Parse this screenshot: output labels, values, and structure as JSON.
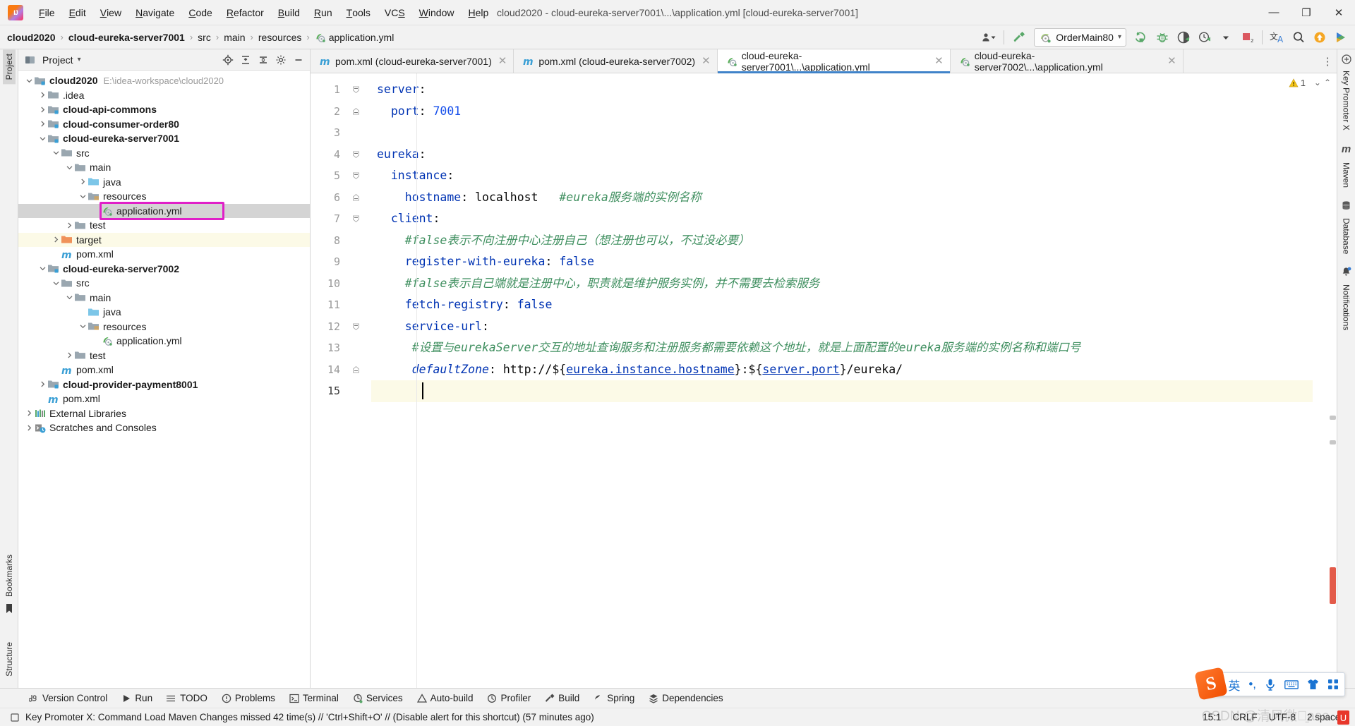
{
  "window": {
    "title": "cloud2020 - cloud-eureka-server7001\\...\\application.yml [cloud-eureka-server7001]",
    "minimize": "—",
    "maximize": "❐",
    "close": "✕"
  },
  "menu": {
    "items": [
      "File",
      "Edit",
      "View",
      "Navigate",
      "Code",
      "Refactor",
      "Build",
      "Run",
      "Tools",
      "VCS",
      "Window",
      "Help"
    ]
  },
  "breadcrumb": {
    "items": [
      "cloud2020",
      "cloud-eureka-server7001",
      "src",
      "main",
      "resources",
      "application.yml"
    ],
    "separator": "›"
  },
  "run_config": {
    "name": "OrderMain80",
    "dropdown": "▾"
  },
  "nav_icons": [
    "user-dropdown-icon",
    "hammer-build-icon",
    "run-icon",
    "debug-icon",
    "run-coverage-icon",
    "run-profile-icon",
    "more-dropdown-icon",
    "stop-icon",
    "translate-icon",
    "search-everywhere-icon",
    "update-icon",
    "ide-eval-icon"
  ],
  "project_panel": {
    "title": "Project",
    "dropdown": "▾",
    "header_icons": [
      "locate-icon",
      "collapse-selection-icon",
      "expand-all-icon",
      "collapse-all-icon",
      "settings-gear-icon",
      "hide-icon"
    ],
    "tree": [
      {
        "depth": 0,
        "arrow": "expanded",
        "icon": "module-folder",
        "label": "cloud2020",
        "bold": true,
        "path": "E:\\idea-workspace\\cloud2020"
      },
      {
        "depth": 1,
        "arrow": "collapsed",
        "icon": "folder",
        "label": ".idea",
        "bold": false
      },
      {
        "depth": 1,
        "arrow": "collapsed",
        "icon": "module-folder",
        "label": "cloud-api-commons",
        "bold": true
      },
      {
        "depth": 1,
        "arrow": "collapsed",
        "icon": "module-folder",
        "label": "cloud-consumer-order80",
        "bold": true
      },
      {
        "depth": 1,
        "arrow": "expanded",
        "icon": "module-folder",
        "label": "cloud-eureka-server7001",
        "bold": true
      },
      {
        "depth": 2,
        "arrow": "expanded",
        "icon": "folder",
        "label": "src",
        "bold": false
      },
      {
        "depth": 3,
        "arrow": "expanded",
        "icon": "folder",
        "label": "main",
        "bold": false
      },
      {
        "depth": 4,
        "arrow": "collapsed",
        "icon": "source-folder",
        "label": "java",
        "bold": false
      },
      {
        "depth": 4,
        "arrow": "expanded",
        "icon": "resource-folder",
        "label": "resources",
        "bold": false
      },
      {
        "depth": 5,
        "arrow": "none",
        "icon": "yml-file",
        "label": "application.yml",
        "bold": false,
        "selected": true,
        "boxed": true
      },
      {
        "depth": 3,
        "arrow": "collapsed",
        "icon": "folder",
        "label": "test",
        "bold": false
      },
      {
        "depth": 2,
        "arrow": "collapsed",
        "icon": "target-folder",
        "label": "target",
        "bold": false,
        "row_highlight": true
      },
      {
        "depth": 2,
        "arrow": "none",
        "icon": "maven-file",
        "label": "pom.xml",
        "bold": false
      },
      {
        "depth": 1,
        "arrow": "expanded",
        "icon": "module-folder",
        "label": "cloud-eureka-server7002",
        "bold": true
      },
      {
        "depth": 2,
        "arrow": "expanded",
        "icon": "folder",
        "label": "src",
        "bold": false
      },
      {
        "depth": 3,
        "arrow": "expanded",
        "icon": "folder",
        "label": "main",
        "bold": false
      },
      {
        "depth": 4,
        "arrow": "none",
        "icon": "source-folder",
        "label": "java",
        "bold": false
      },
      {
        "depth": 4,
        "arrow": "expanded",
        "icon": "resource-folder",
        "label": "resources",
        "bold": false
      },
      {
        "depth": 5,
        "arrow": "none",
        "icon": "yml-file",
        "label": "application.yml",
        "bold": false
      },
      {
        "depth": 3,
        "arrow": "collapsed",
        "icon": "folder",
        "label": "test",
        "bold": false
      },
      {
        "depth": 2,
        "arrow": "none",
        "icon": "maven-file",
        "label": "pom.xml",
        "bold": false
      },
      {
        "depth": 1,
        "arrow": "collapsed",
        "icon": "module-folder",
        "label": "cloud-provider-payment8001",
        "bold": true
      },
      {
        "depth": 1,
        "arrow": "none",
        "icon": "maven-file",
        "label": "pom.xml",
        "bold": false
      },
      {
        "depth": 0,
        "arrow": "collapsed",
        "icon": "library-icon",
        "label": "External Libraries",
        "bold": false
      },
      {
        "depth": 0,
        "arrow": "collapsed",
        "icon": "scratches-icon",
        "label": "Scratches and Consoles",
        "bold": false
      }
    ]
  },
  "left_rail": {
    "tabs": [
      "Project",
      "Bookmarks",
      "Structure"
    ]
  },
  "right_rail": {
    "tabs": [
      "Key Promoter X",
      "Maven",
      "Database",
      "Notifications"
    ]
  },
  "editor_tabs": [
    {
      "icon": "maven-file",
      "label": "pom.xml (cloud-eureka-server7001)",
      "active": false,
      "close": "✕"
    },
    {
      "icon": "maven-file",
      "label": "pom.xml (cloud-eureka-server7002)",
      "active": false,
      "close": "✕"
    },
    {
      "icon": "yml-file",
      "label": "cloud-eureka-server7001\\...\\application.yml",
      "active": true,
      "close": "✕"
    },
    {
      "icon": "yml-file",
      "label": "cloud-eureka-server7002\\...\\application.yml",
      "active": false,
      "close": "✕"
    }
  ],
  "editor": {
    "warning_count": "1",
    "line_numbers": [
      "1",
      "2",
      "3",
      "4",
      "5",
      "6",
      "7",
      "8",
      "9",
      "10",
      "11",
      "12",
      "13",
      "14",
      "15"
    ],
    "current_line": 15,
    "lines": [
      {
        "n": 1,
        "fold": "minus-tri",
        "tokens": [
          {
            "t": "server",
            "c": "k"
          },
          {
            "t": ":",
            "c": "plain"
          }
        ]
      },
      {
        "n": 2,
        "fold": "minus-end",
        "tokens": [
          {
            "t": "  ",
            "c": "plain"
          },
          {
            "t": "port",
            "c": "k"
          },
          {
            "t": ": ",
            "c": "plain"
          },
          {
            "t": "7001",
            "c": "num"
          }
        ]
      },
      {
        "n": 3,
        "fold": "",
        "tokens": []
      },
      {
        "n": 4,
        "fold": "minus-tri",
        "tokens": [
          {
            "t": "eureka",
            "c": "k"
          },
          {
            "t": ":",
            "c": "plain"
          }
        ]
      },
      {
        "n": 5,
        "fold": "minus-tri",
        "tokens": [
          {
            "t": "  ",
            "c": "plain"
          },
          {
            "t": "instance",
            "c": "k"
          },
          {
            "t": ":",
            "c": "plain"
          }
        ]
      },
      {
        "n": 6,
        "fold": "minus-end",
        "tokens": [
          {
            "t": "    ",
            "c": "plain"
          },
          {
            "t": "hostname",
            "c": "k"
          },
          {
            "t": ": ",
            "c": "plain"
          },
          {
            "t": "localhost",
            "c": "plain"
          },
          {
            "t": "   ",
            "c": "plain"
          },
          {
            "t": "#eureka服务端的实例名称",
            "c": "cmt"
          }
        ]
      },
      {
        "n": 7,
        "fold": "minus-tri",
        "tokens": [
          {
            "t": "  ",
            "c": "plain"
          },
          {
            "t": "client",
            "c": "k"
          },
          {
            "t": ":",
            "c": "plain"
          }
        ]
      },
      {
        "n": 8,
        "fold": "",
        "tokens": [
          {
            "t": "    ",
            "c": "plain"
          },
          {
            "t": "#false表示不向注册中心注册自己（想注册也可以，不过没必要）",
            "c": "cmt"
          }
        ]
      },
      {
        "n": 9,
        "fold": "",
        "tokens": [
          {
            "t": "    ",
            "c": "plain"
          },
          {
            "t": "register-with-eureka",
            "c": "k"
          },
          {
            "t": ": ",
            "c": "plain"
          },
          {
            "t": "false",
            "c": "val"
          }
        ]
      },
      {
        "n": 10,
        "fold": "",
        "tokens": [
          {
            "t": "    ",
            "c": "plain"
          },
          {
            "t": "#false表示自己端就是注册中心，职责就是维护服务实例，并不需要去检索服务",
            "c": "cmt"
          }
        ]
      },
      {
        "n": 11,
        "fold": "",
        "tokens": [
          {
            "t": "    ",
            "c": "plain"
          },
          {
            "t": "fetch-registry",
            "c": "k"
          },
          {
            "t": ": ",
            "c": "plain"
          },
          {
            "t": "false",
            "c": "val"
          }
        ]
      },
      {
        "n": 12,
        "fold": "minus-tri",
        "tokens": [
          {
            "t": "    ",
            "c": "plain"
          },
          {
            "t": "service-url",
            "c": "k"
          },
          {
            "t": ":",
            "c": "plain"
          }
        ]
      },
      {
        "n": 13,
        "fold": "",
        "tokens": [
          {
            "t": "     ",
            "c": "plain"
          },
          {
            "t": "#设置与eurekaServer交互的地址查询服务和注册服务都需要依赖这个地址，就是上面配置的eureka服务端的实例名称和端口号",
            "c": "cmt"
          }
        ]
      },
      {
        "n": 14,
        "fold": "minus-end",
        "tokens": [
          {
            "t": "     ",
            "c": "plain"
          },
          {
            "t": "defaultZone",
            "c": "ital"
          },
          {
            "t": ": ",
            "c": "plain"
          },
          {
            "t": "http://${",
            "c": "plain"
          },
          {
            "t": "eureka.instance.hostname",
            "c": "ref"
          },
          {
            "t": "}:${",
            "c": "plain"
          },
          {
            "t": "server.port",
            "c": "ref"
          },
          {
            "t": "}/eureka/",
            "c": "plain"
          }
        ]
      },
      {
        "n": 15,
        "fold": "",
        "tokens": []
      }
    ]
  },
  "tool_windows": [
    {
      "icon": "version-control-icon",
      "label": "Version Control"
    },
    {
      "icon": "run-icon",
      "label": "Run"
    },
    {
      "icon": "todo-icon",
      "label": "TODO"
    },
    {
      "icon": "problems-icon",
      "label": "Problems"
    },
    {
      "icon": "terminal-icon",
      "label": "Terminal"
    },
    {
      "icon": "services-icon",
      "label": "Services"
    },
    {
      "icon": "auto-build-icon",
      "label": "Auto-build"
    },
    {
      "icon": "profiler-icon",
      "label": "Profiler"
    },
    {
      "icon": "build-icon",
      "label": "Build"
    },
    {
      "icon": "spring-icon",
      "label": "Spring"
    },
    {
      "icon": "dependencies-icon",
      "label": "Dependencies"
    }
  ],
  "status_bar": {
    "message": "Key Promoter X: Command Load Maven Changes missed 42 time(s) // 'Ctrl+Shift+O' // (Disable alert for this shortcut) (57 minutes ago)",
    "caret": "15:1",
    "line_separator": "CRLF",
    "encoding": "UTF-8",
    "indent": "2 spaces"
  },
  "ime_bar": {
    "logo": "S",
    "items": [
      "英",
      "•,",
      "microphone-icon",
      "keyboard-icon",
      "skin-icon",
      "apps-icon"
    ]
  },
  "watermark": "CSDN @清风微凉̱aaa",
  "colors": {
    "accent_blue": "#4083c9",
    "selection_box": "#e020c8",
    "keyword": "#0033b3",
    "comment": "#3f8f5f",
    "number": "#1750eb",
    "current_line": "#fcfae7",
    "sel_row": "#d4d4d4"
  }
}
